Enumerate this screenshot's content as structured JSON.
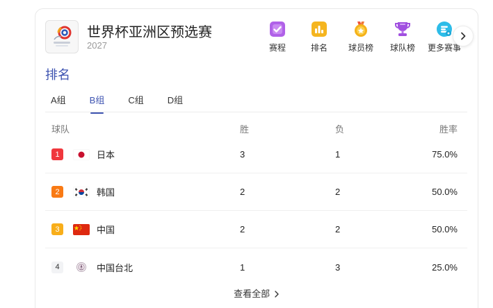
{
  "header": {
    "title": "世界杯亚洲区预选赛",
    "year": "2027"
  },
  "nav": [
    {
      "label": "赛程",
      "icon": "schedule-check-icon",
      "color": "#b061e8"
    },
    {
      "label": "排名",
      "icon": "ranking-bars-icon",
      "color": "#f5b51f"
    },
    {
      "label": "球员榜",
      "icon": "medal-icon",
      "color": "#f2a51a"
    },
    {
      "label": "球队榜",
      "icon": "trophy-icon",
      "color": "#a150e0"
    },
    {
      "label": "更多赛事",
      "icon": "more-events-icon",
      "color": "#2dbce8"
    }
  ],
  "section": {
    "title": "排名"
  },
  "tabs": [
    {
      "label": "A组",
      "active": false
    },
    {
      "label": "B组",
      "active": true
    },
    {
      "label": "C组",
      "active": false
    },
    {
      "label": "D组",
      "active": false
    }
  ],
  "table": {
    "headers": {
      "team": "球队",
      "wins": "胜",
      "losses": "负",
      "rate": "胜率"
    },
    "rows": [
      {
        "rank": "1",
        "rank_color": "#f0373d",
        "flag": "japan-flag-icon",
        "team": "日本",
        "wins": "3",
        "losses": "1",
        "rate": "75.0%"
      },
      {
        "rank": "2",
        "rank_color": "#f97a14",
        "flag": "korea-flag-icon",
        "team": "韩国",
        "wins": "2",
        "losses": "2",
        "rate": "50.0%"
      },
      {
        "rank": "3",
        "rank_color": "#f8ae1a",
        "flag": "china-flag-icon",
        "team": "中国",
        "wins": "2",
        "losses": "2",
        "rate": "50.0%"
      },
      {
        "rank": "4",
        "rank_color": "#f2f3f5",
        "flag": "chinese-taipei-flag-icon",
        "team": "中国台北",
        "wins": "1",
        "losses": "3",
        "rate": "25.0%"
      }
    ]
  },
  "footer": {
    "view_all": "查看全部"
  }
}
